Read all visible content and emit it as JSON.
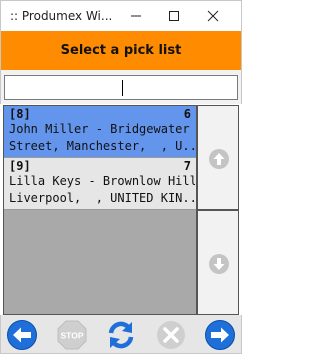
{
  "window": {
    "title": ":: Produmex Wi..."
  },
  "header": {
    "title": "Select a pick list"
  },
  "search": {
    "value": "",
    "placeholder": ""
  },
  "pick_lists": [
    {
      "id": "[8]",
      "count": "6",
      "line1": "John Miller - Bridgewater",
      "line2": "Street, Manchester,  , U...",
      "selected": true
    },
    {
      "id": "[9]",
      "count": "7",
      "line1": "Lilla Keys - Brownlow Hill,",
      "line2": "Liverpool,  , UNITED KIN...",
      "selected": false
    }
  ],
  "toolbar": {
    "stop_label": "STOP"
  },
  "colors": {
    "accent": "#ff8c00",
    "selection": "#6495ed",
    "nav_blue": "#1e6fd9"
  }
}
